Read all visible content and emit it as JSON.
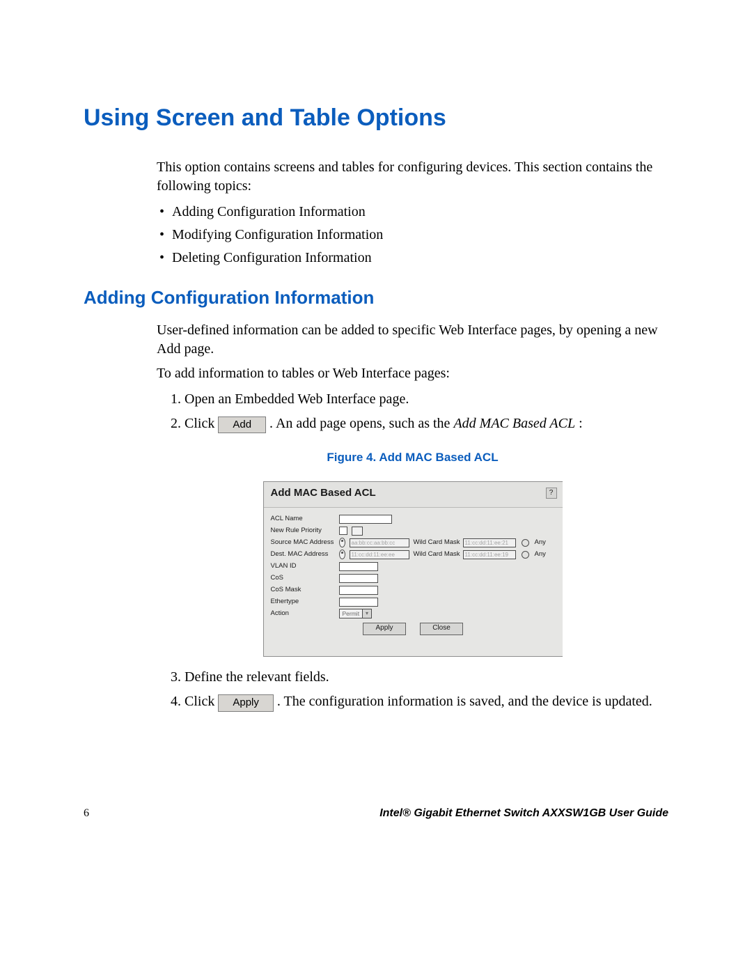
{
  "h1": "Using Screen and Table Options",
  "intro": "This option contains screens and tables for configuring devices. This section contains the following topics:",
  "bullets": [
    "Adding Configuration Information",
    "Modifying Configuration Information",
    "Deleting Configuration Information"
  ],
  "h2": "Adding Configuration Information",
  "para1": "User-defined information can be added to specific Web Interface pages, by opening a new Add page.",
  "para2": "To add information to tables or Web Interface pages:",
  "steps": {
    "s1": "Open an Embedded Web Interface page.",
    "s2_a": "Click ",
    "s2_btn": "Add",
    "s2_b": ". An add page opens, such as the ",
    "s2_em": "Add MAC Based ACL",
    "s2_c": ":",
    "s3": "Define the relevant fields.",
    "s4_a": "Click ",
    "s4_btn": "Apply",
    "s4_b": ". The configuration information is saved, and the device is updated."
  },
  "fig_caption": "Figure 4. Add MAC Based ACL",
  "dialog": {
    "title": "Add MAC Based ACL",
    "help": "?",
    "labels": {
      "acl": "ACL Name",
      "rule": "New Rule Priority",
      "src": "Source MAC Address",
      "dst": "Dest. MAC Address",
      "vlan": "VLAN ID",
      "cos": "CoS",
      "cosmask": "CoS Mask",
      "eth": "Ethertype",
      "act": "Action"
    },
    "mask": "Wild Card Mask",
    "any": "Any",
    "action_value": "Permit",
    "apply": "Apply",
    "close": "Close",
    "src_val": "aa:bb:cc:aa:bb:cc",
    "dst_val": "11:cc:dd:11:ee:ee",
    "src_mask_val": "11:cc:dd:11:ee:21",
    "dst_mask_val": "11:cc:dd:11:ee:19"
  },
  "footer": {
    "page": "6",
    "title": "Intel® Gigabit Ethernet Switch AXXSW1GB User Guide"
  }
}
